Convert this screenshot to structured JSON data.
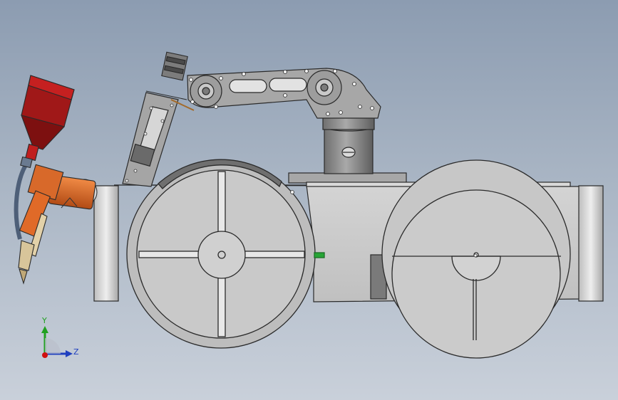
{
  "viewport": {
    "background_top": "#8c9cb1",
    "background_bottom": "#c9d0da"
  },
  "model": {
    "body_color": "#c8c8c8",
    "edge_color": "#2a2a2a",
    "hopper_color": "#8e1212",
    "torch_color": "#e06a28",
    "hose_color": "#5b6b80"
  },
  "triad": {
    "y_label": "Y",
    "z_label": "Z",
    "y_color": "#20a020",
    "z_color": "#1f3fbf",
    "x_color": "#d01010"
  }
}
